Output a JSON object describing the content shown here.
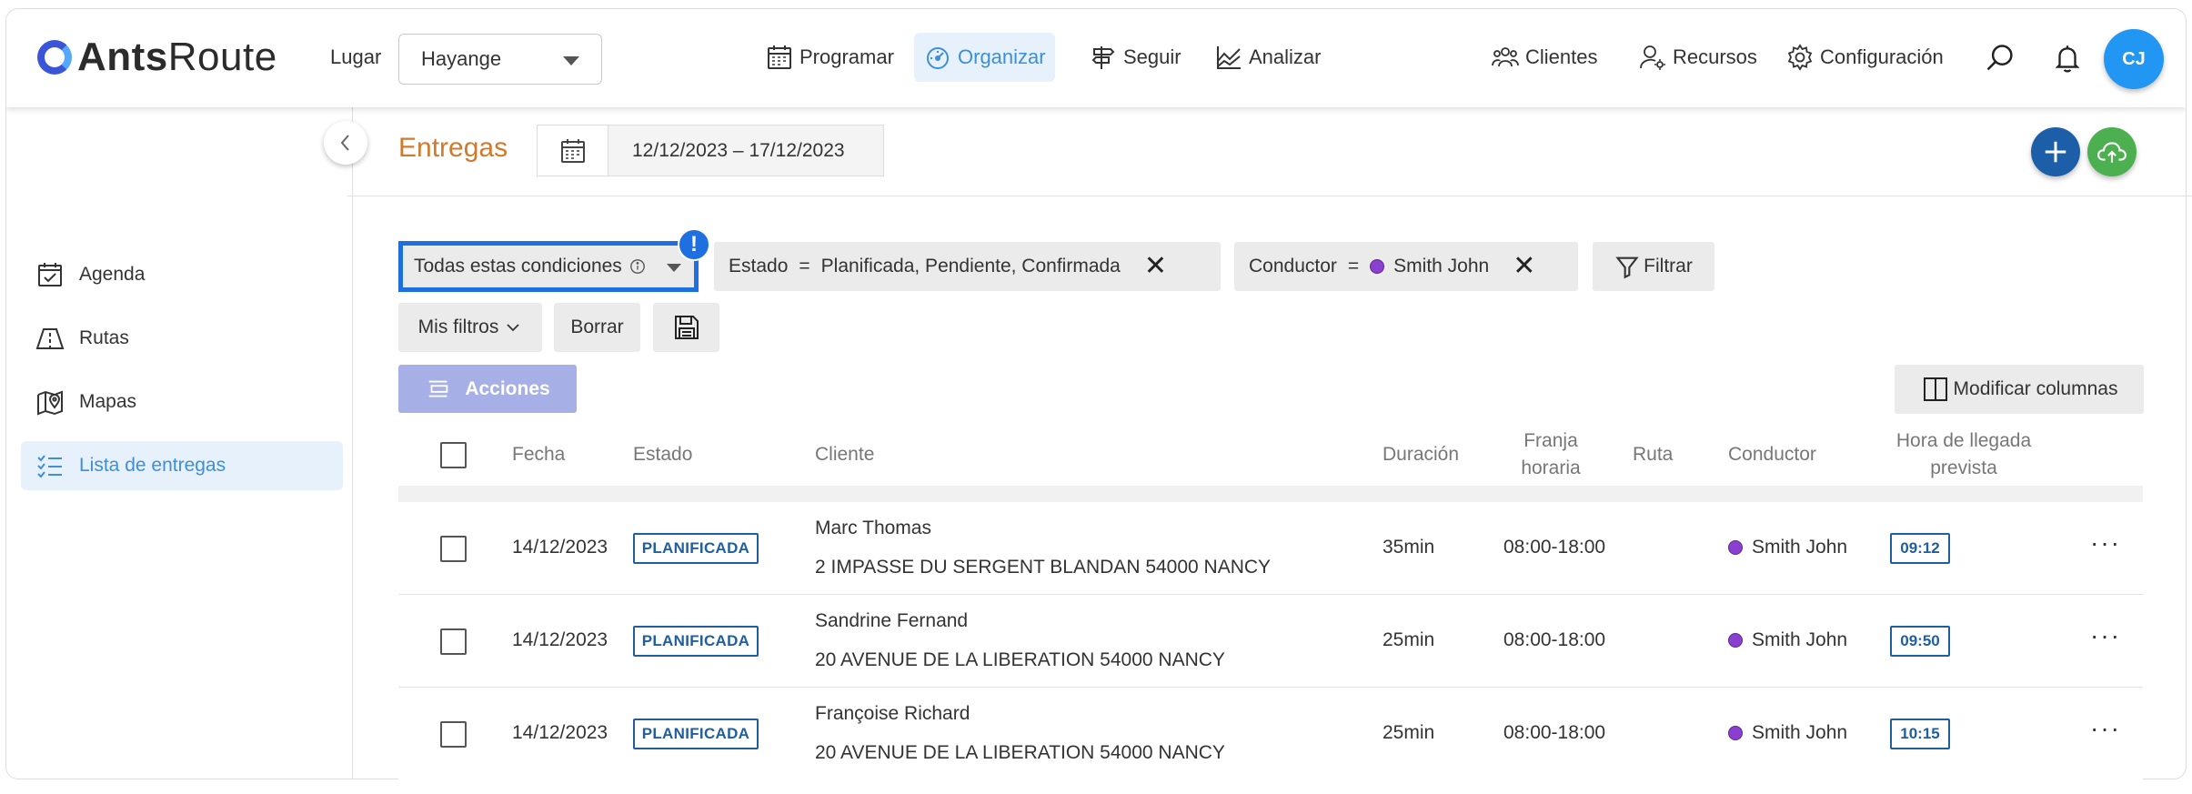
{
  "header": {
    "logo_text_bold": "Ants",
    "logo_text_regular": "Route",
    "lugar_label": "Lugar",
    "lugar_value": "Hayange",
    "nav": [
      {
        "label": "Programar",
        "icon": "calendar-grid-icon",
        "active": false
      },
      {
        "label": "Organizar",
        "icon": "gauge-icon",
        "active": true
      },
      {
        "label": "Seguir",
        "icon": "signpost-icon",
        "active": false
      },
      {
        "label": "Analizar",
        "icon": "chart-line-icon",
        "active": false
      },
      {
        "label": "Clientes",
        "icon": "users-icon",
        "active": false
      },
      {
        "label": "Recursos",
        "icon": "user-gear-icon",
        "active": false
      },
      {
        "label": "Configuración",
        "icon": "gear-icon",
        "active": false
      }
    ],
    "avatar_initials": "CJ",
    "accent_color": "#3d8fd6"
  },
  "sidebar": {
    "items": [
      {
        "label": "Agenda",
        "icon": "calendar-check-icon",
        "active": false
      },
      {
        "label": "Rutas",
        "icon": "route-icon",
        "active": false
      },
      {
        "label": "Mapas",
        "icon": "map-pin-icon",
        "active": false
      },
      {
        "label": "Lista de entregas",
        "icon": "checklist-icon",
        "active": true
      }
    ]
  },
  "page": {
    "title": "Entregas",
    "date_range": "12/12/2023 – 17/12/2023",
    "title_color": "#d17a2b"
  },
  "filters": {
    "condition_mode": "Todas estas condiciones",
    "alert_mark": "!",
    "chips": [
      {
        "field": "Estado",
        "op": "=",
        "value": "Planificada, Pendiente, Confirmada"
      },
      {
        "field": "Conductor",
        "op": "=",
        "value": "Smith John"
      }
    ],
    "filter_button": "Filtrar",
    "my_filters": "Mis filtros",
    "clear": "Borrar"
  },
  "actions": {
    "acciones": "Acciones",
    "modify_columns": "Modificar columnas"
  },
  "table": {
    "columns": {
      "fecha": "Fecha",
      "estado": "Estado",
      "cliente": "Cliente",
      "duracion": "Duración",
      "franja_1": "Franja",
      "franja_2": "horaria",
      "ruta": "Ruta",
      "conductor": "Conductor",
      "hora_1": "Hora de llegada",
      "hora_2": "prevista"
    },
    "rows": [
      {
        "fecha": "14/12/2023",
        "estado": "PLANIFICADA",
        "cliente": "Marc Thomas",
        "direccion": "2 IMPASSE DU SERGENT BLANDAN 54000 NANCY",
        "duracion": "35min",
        "franja": "08:00-18:00",
        "ruta": "",
        "conductor": "Smith John",
        "hora": "09:12"
      },
      {
        "fecha": "14/12/2023",
        "estado": "PLANIFICADA",
        "cliente": "Sandrine Fernand",
        "direccion": "20 AVENUE DE LA LIBERATION 54000 NANCY",
        "duracion": "25min",
        "franja": "08:00-18:00",
        "ruta": "",
        "conductor": "Smith John",
        "hora": "09:50"
      },
      {
        "fecha": "14/12/2023",
        "estado": "PLANIFICADA",
        "cliente": "Françoise Richard",
        "direccion": "20 AVENUE DE LA LIBERATION 54000 NANCY",
        "duracion": "25min",
        "franja": "08:00-18:00",
        "ruta": "",
        "conductor": "Smith John",
        "hora": "10:15"
      }
    ],
    "more_label": "···"
  }
}
